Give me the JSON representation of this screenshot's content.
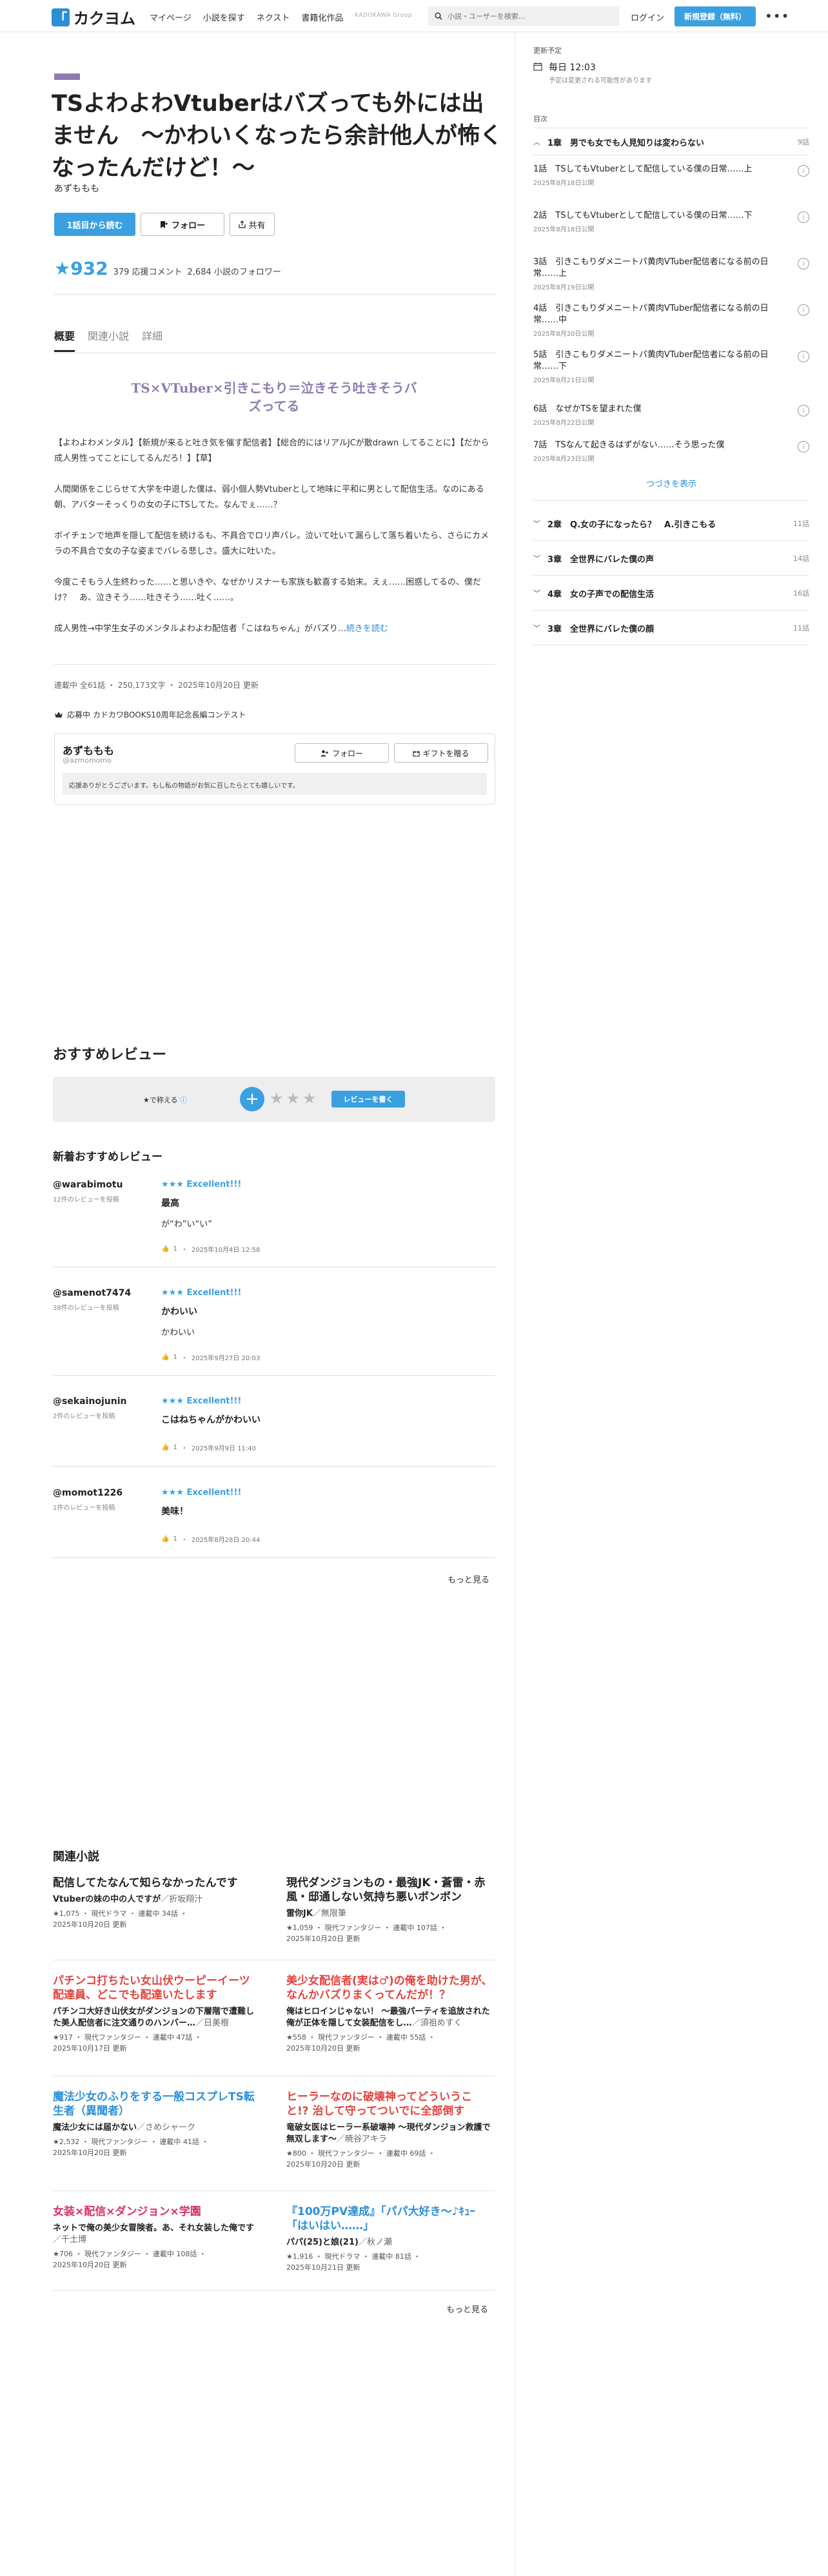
{
  "header": {
    "logo_text": "カクヨム",
    "nav": [
      "マイページ",
      "小説を探す",
      "ネクスト",
      "書籍化作品"
    ],
    "kadokawa": "KADOKAWA Group",
    "search_placeholder": "小説・ユーザーを検索…",
    "login": "ログイン",
    "signup": "新規登録（無料）"
  },
  "work": {
    "title": "TSよわよわVtuberはバズっても外には出ません　～かわいくなったら余計他人が怖くなったんだけど！～",
    "author": "あずももも",
    "read_button": "1話目から読む",
    "follow_button": "フォロー",
    "share_button": "共有",
    "stars": "★932",
    "review_comments": "379 応援コメント",
    "followers": "2,684 小説のフォロワー",
    "tabs": [
      "概要",
      "関連小説",
      "詳細"
    ],
    "catchphrase": "TS×VTuber×引きこもり＝泣きそう吐きそうバズってる",
    "intro": [
      "【よわよわメンタル】【新規が来ると吐き気を催す配信者】【総合的にはリアルJCが散drawn してることに】【だから成人男性ってことにしてるんだろ！】【草】",
      "人間関係をこじらせて大学を中退した僕は、弱小個人勢Vtuberとして地味に平和に男として配信生活。なのにある朝、アバターそっくりの女の子にTSしてた。なんでぇ……？",
      "ボイチェンで地声を隠して配信を続けるも、不具合でロリ声バレ。泣いて吐いて漏らして落ち着いたら、さらにカメラの不具合で女の子な姿までバレる悲しさ。盛大に吐いた。",
      "今度こそもう人生終わった……と思いきや、なぜかリスナーも家族も歓喜する始末。えぇ……困惑してるの、僕だけ？　あ、泣きそう……吐きそう……吐く……。",
      "成人男性→中学生女子のメンタルよわよわ配信者「こはねちゃん」がバズり…"
    ],
    "read_more": "続きを読む",
    "meta": "連載中 全61話 ・ 250,173文字 ・ 2025年10月20日 更新",
    "contest": "応募中 カドカワBOOKS10周年記念長編コンテスト"
  },
  "author_box": {
    "name": "あずももも",
    "handle": "@azmomomo",
    "follow": "フォロー",
    "gift": "ギフトを贈る",
    "message": "応援ありがとうございます。もし私の物語がお気に召したらとても嬉しいです。"
  },
  "reviews_section": {
    "heading": "おすすめレビュー",
    "form_label": "★で称える",
    "form_stars": "★★★",
    "write_button": "レビューを書く",
    "sub_heading": "新着おすすめレビュー",
    "items": [
      {
        "user": "@warabimotu",
        "count": "12件のレビューを投稿",
        "rating": "★★★ Excellent!!!",
        "title": "最高",
        "body": "が“わ”い“い”",
        "likes": "1",
        "date": "2025年10月4日 12:58"
      },
      {
        "user": "@samenot7474",
        "count": "38件のレビューを投稿",
        "rating": "★★★ Excellent!!!",
        "title": "かわいい",
        "body": "かわいい",
        "likes": "1",
        "date": "2025年9月27日 20:03"
      },
      {
        "user": "@sekainojunin",
        "count": "2件のレビューを投稿",
        "rating": "★★★ Excellent!!!",
        "title": "こはねちゃんがかわいい",
        "body": "",
        "likes": "1",
        "date": "2025年9月9日 11:40"
      },
      {
        "user": "@momot1226",
        "count": "1件のレビューを投稿",
        "rating": "★★★ Excellent!!!",
        "title": "美味！",
        "body": "",
        "likes": "1",
        "date": "2025年8月28日 20:44"
      }
    ],
    "more": "もっと見る"
  },
  "related": {
    "heading": "関連小説",
    "more": "もっと見る",
    "items": [
      {
        "title": "配信してたなんて知らなかったんです",
        "title_color": "#222222",
        "catch": "Vtuberの妹の中の人ですが",
        "author": "／折坂翔汁",
        "meta1": "★1,075 ・ 現代ドラマ ・ 連載中 34話 ・",
        "meta2": "2025年10月20日 更新"
      },
      {
        "title": "現代ダンジョンもの・最強JK・蒼雷・赤風・邸通しない気持ち悪いボンボン",
        "title_color": "#222222",
        "catch": "雷你JK",
        "author": "／無限筆",
        "meta1": "★1,059 ・ 現代ファンタジー ・ 連載中 107話 ・",
        "meta2": "2025年10月20日 更新"
      },
      {
        "title": "パチンコ打ちたい女山伏ウーピーイーツ配達員、どこでも配達いたします",
        "title_color": "#e0443e",
        "catch": "パチンコ大好き山伏女がダンジョンの下層階で遭難した美人配信者に注文通りのハンバー…",
        "author": "／日美根",
        "meta1": "★917 ・ 現代ファンタジー ・ 連載中 47話 ・",
        "meta2": "2025年10月17日 更新"
      },
      {
        "title": "美少女配信者(実は♂)の俺を助けた男が、なんかバズりまくってんだが！？",
        "title_color": "#e0443e",
        "catch": "俺はヒロインじゃない！ ～最強パーティを追放された俺が正体を隠して女装配信をし…",
        "author": "／須祖めすく",
        "meta1": "★558 ・ 現代ファンタジー ・ 連載中 55話 ・",
        "meta2": "2025年10月20日 更新"
      },
      {
        "title": "魔法少女のふりをする一般コスプレTS転生者（異聞者）",
        "title_color": "#2c8fd6",
        "catch": "魔法少女には届かない",
        "author": "／さめシャーク",
        "meta1": "★2,532 ・ 現代ファンタジー ・ 連載中 41話 ・",
        "meta2": "2025年10月20日 更新"
      },
      {
        "title": "ヒーラーなのに破壊神ってどういうこと!? 治して守ってついでに全部倒す",
        "title_color": "#e0443e",
        "catch": "竜破女医はヒーラー系破壊神 ～現代ダンジョン救護で無双します～",
        "author": "／暁谷アキラ",
        "meta1": "★800 ・ 現代ファンタジー ・ 連載中 69話 ・",
        "meta2": "2025年10月20日 更新"
      },
      {
        "title": "女装×配信×ダンジョン×学園",
        "title_color": "#d6306e",
        "catch": "ネットで俺の美少女冒険者。あ、それ女装した俺です",
        "author": "／千土博",
        "meta1": "★706 ・ 現代ファンタジー ・ 連載中 108話 ・",
        "meta2": "2025年10月20日 更新"
      },
      {
        "title": "『100万PV達成』「パパ大好き～♪ｷｭｰ「はいはい……」",
        "title_color": "#2c8fd6",
        "catch": "パパ(25)と娘(21)",
        "author": "／秋ノ瀬",
        "meta1": "★1,916 ・ 現代ドラマ ・ 連載中 81話 ・",
        "meta2": "2025年10月21日 更新"
      }
    ]
  },
  "sidebar": {
    "schedule_label": "更新予定",
    "schedule_time": "毎日 12:03",
    "schedule_note": "予定は変更される可能性があります",
    "toc_label": "目次",
    "chapter1": {
      "name": "1章　男でも女でも人見知りは変わらない",
      "count": "9話"
    },
    "episodes": [
      {
        "title": "1話　TSしてもVtuberとして配信している僕の日常……上",
        "date": "2025年8月18日公開"
      },
      {
        "title": "2話　TSしてもVtuberとして配信している僕の日常……下",
        "date": "2025年8月18日公開"
      },
      {
        "title": "3話　引きこもりダメニートパ黄肉VTuber配信者になる前の日常……上",
        "date": "2025年8月19日公開"
      },
      {
        "title": "4話　引きこもりダメニートパ黄肉VTuber配信者になる前の日常……中",
        "date": "2025年8月20日公開"
      },
      {
        "title": "5話　引きこもりダメニートパ黄肉VTuber配信者になる前の日常……下",
        "date": "2025年8月21日公開"
      },
      {
        "title": "6話　なぜかTSを望まれた僕",
        "date": "2025年8月22日公開"
      },
      {
        "title": "7話　TSなんて起きるはずがない……そう思った僕",
        "date": "2025年8月23日公開"
      }
    ],
    "next": "つづきを表示",
    "chapters": [
      {
        "name": "2章　Q.女の子になったら？　A.引きこもる",
        "count": "11話"
      },
      {
        "name": "3章　全世界にバレた僕の声",
        "count": "14話"
      },
      {
        "name": "4章　女の子声での配信生活",
        "count": "16話"
      },
      {
        "name": "3章　全世界にバレた僕の顔",
        "count": "11話"
      }
    ]
  }
}
